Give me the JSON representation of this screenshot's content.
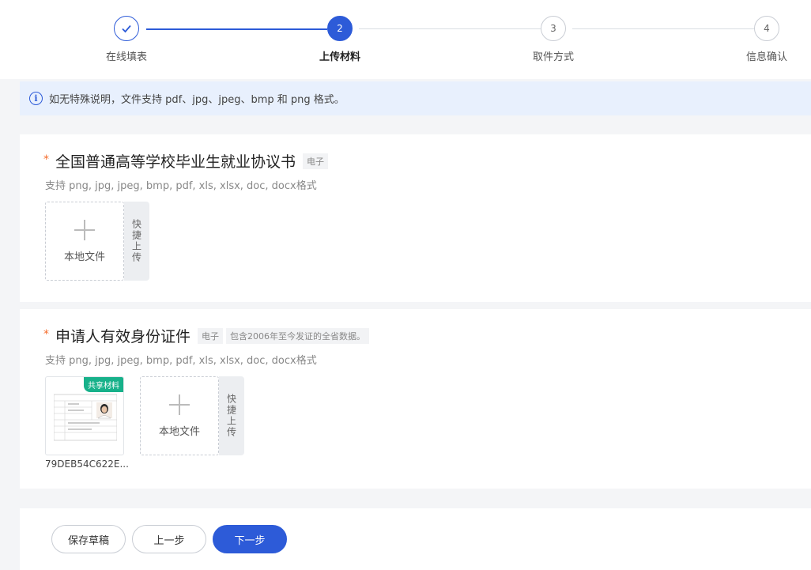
{
  "steps": [
    {
      "num": "",
      "label": "在线填表",
      "state": "done"
    },
    {
      "num": "2",
      "label": "上传材料",
      "state": "active"
    },
    {
      "num": "3",
      "label": "取件方式",
      "state": "todo"
    },
    {
      "num": "4",
      "label": "信息确认",
      "state": "todo"
    }
  ],
  "info": {
    "icon": "info-icon",
    "text": "如无特殊说明，文件支持 pdf、jpg、jpeg、bmp 和 png 格式。"
  },
  "materials": [
    {
      "required": "*",
      "title": "全国普通高等学校毕业生就业协议书",
      "tag": "电子",
      "support": "支持 png, jpg, jpeg, bmp, pdf, xls, xlsx, doc, docx格式",
      "upload_label": "本地文件",
      "quick_upload": "快捷上传"
    },
    {
      "required": "*",
      "title": "申请人有效身份证件",
      "tag": "电子",
      "note": "包含2006年至今发证的全省数据。",
      "support": "支持 png, jpg, jpeg, bmp, pdf, xls, xlsx, doc, docx格式",
      "shared_badge": "共享材料",
      "file_name": "79DEB54C622E...",
      "upload_label": "本地文件",
      "quick_upload": "快捷上传"
    }
  ],
  "footer": {
    "save_draft": "保存草稿",
    "prev": "上一步",
    "next": "下一步"
  },
  "colors": {
    "primary": "#2d5bd8",
    "shared": "#17b18a",
    "required": "#f56c2c"
  }
}
